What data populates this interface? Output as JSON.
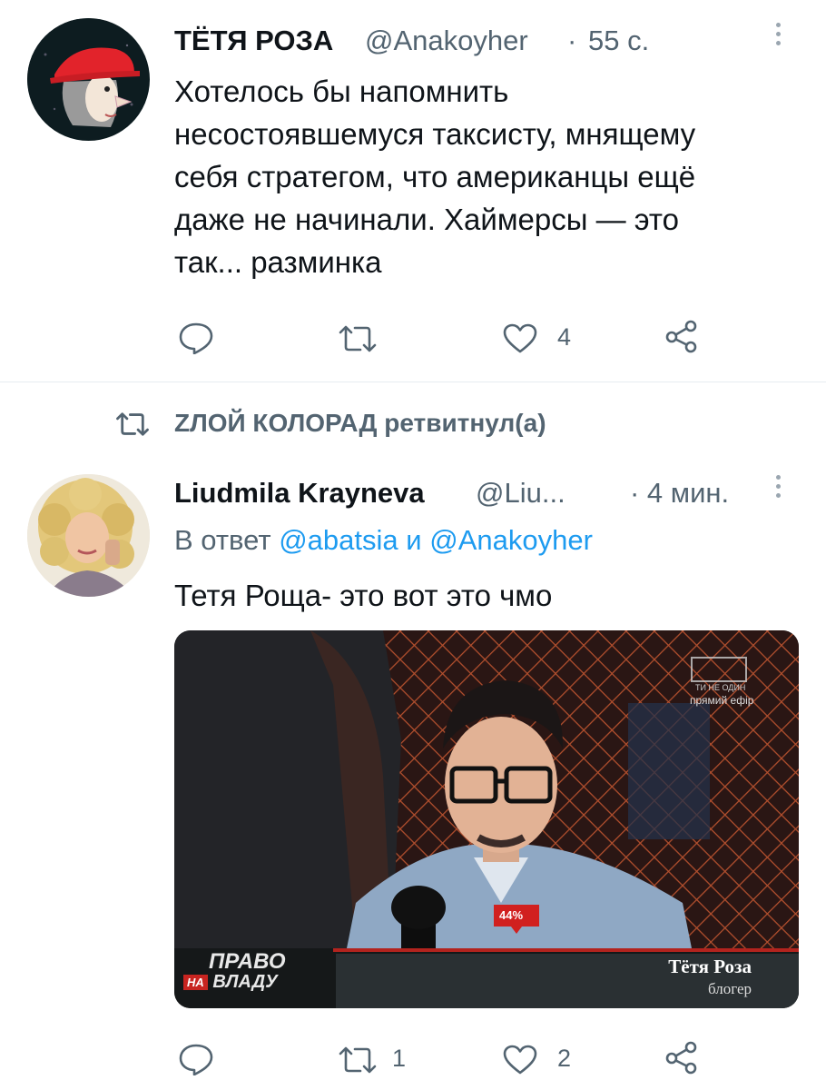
{
  "tweet1": {
    "author_name": "ТЁТЯ РОЗА",
    "handle": "@Anakoyher",
    "separator": "·",
    "time": "55 с.",
    "text_lines": [
      "Хотелось бы напомнить",
      "несостоявшемуся таксисту, мнящему",
      "себя стратегом, что американцы ещё",
      "даже не начинали. Хаймерсы — это",
      "так... разминка"
    ],
    "like_count": "4",
    "icons": [
      "reply-icon",
      "retweet-icon",
      "like-icon",
      "share-icon",
      "more-icon"
    ]
  },
  "retweet_banner": {
    "text": "ZЛОЙ КОЛОРАД ретвитнул(а)"
  },
  "tweet2": {
    "author_name": "Liudmila Krayneva",
    "handle": "@Liu...",
    "time": "· 4 мин.",
    "reply_prefix": "В ответ",
    "mention1": "@abatsia",
    "reply_and": "и",
    "mention2": "@Anakoyher",
    "text": "Тетя Роща- это вот это чмо",
    "media": {
      "show_title_top": "ПРАВО",
      "show_title_na": "НА",
      "show_title_bottom": "ВЛАДУ",
      "lower_third_name": "Тётя Роза",
      "lower_third_role": "блогер",
      "percent_badge": "44%",
      "channel_line1": "ТИ НЕ ОДИН",
      "channel_line2": "прямий ефір"
    },
    "retweet_count": "1",
    "like_count": "2"
  },
  "colors": {
    "accent": "#1d9bf0",
    "text": "#0f1419",
    "muted": "#536471",
    "divider": "#e6ecf0"
  }
}
